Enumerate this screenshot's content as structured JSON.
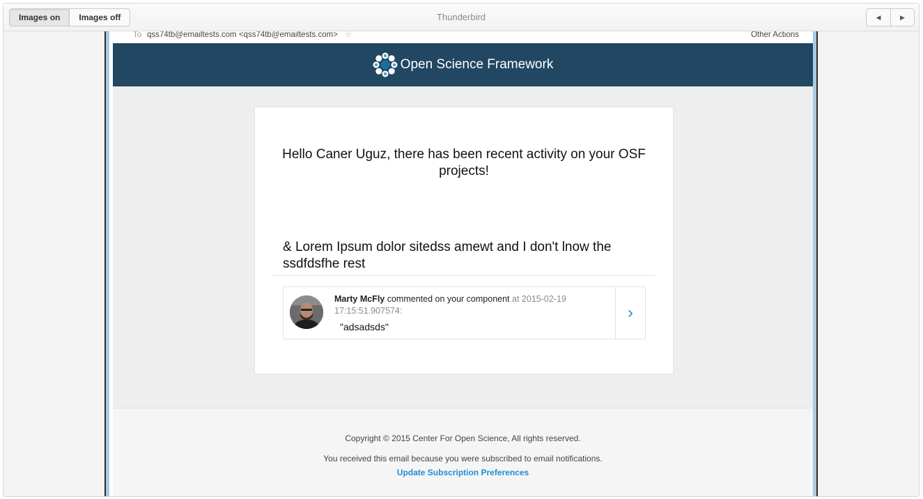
{
  "toolbar": {
    "images_on": "Images on",
    "images_off": "Images off",
    "title": "Thunderbird",
    "prev_icon": "triangle-left",
    "next_icon": "triangle-right"
  },
  "message_header": {
    "to_label": "To",
    "to_address": "qss74tb@emailtests.com <qss74tb@emailtests.com>",
    "other_actions": "Other Actions"
  },
  "email": {
    "brand": "Open Science Framework",
    "greeting": "Hello Caner Uguz, there has been recent activity on your OSF projects!",
    "project_title": "& Lorem Ipsum dolor sitedss amewt and I don't lnow the ssdfdsfhe rest",
    "notification": {
      "actor": "Marty McFly",
      "action": "commented on your component",
      "timestamp": "at 2015-02-19 17:15:51.907574:",
      "comment": "\"adsadsds\"",
      "arrow": "›"
    },
    "footer": {
      "copyright": "Copyright © 2015 Center For Open Science, All rights reserved.",
      "received": "You received this email because you were subscribed to email notifications.",
      "preferences_link": "Update Subscription Preferences"
    }
  },
  "colors": {
    "banner": "#214762",
    "link": "#1f8ecd",
    "email_background": "#eeeeee"
  }
}
